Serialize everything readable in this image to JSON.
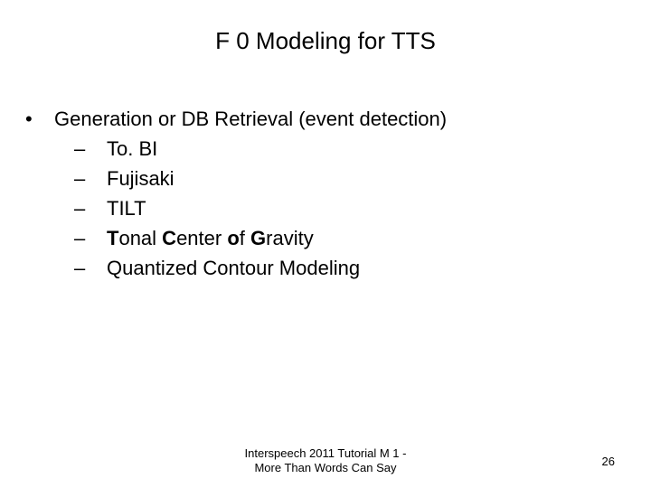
{
  "title": "F 0 Modeling for TTS",
  "main_bullet": "Generation or DB Retrieval (event detection)",
  "sub": {
    "a": "To. BI",
    "b": "Fujisaki",
    "c": "TILT",
    "d_T": "T",
    "d_onal": "onal ",
    "d_C": "C",
    "d_enter": "enter ",
    "d_o": "o",
    "d_f": "f ",
    "d_G": "G",
    "d_ravity": "ravity",
    "e": "Quantized Contour Modeling"
  },
  "footer": {
    "line1": "Interspeech 2011 Tutorial M 1 -",
    "line2": "More Than Words Can Say"
  },
  "page": "26"
}
